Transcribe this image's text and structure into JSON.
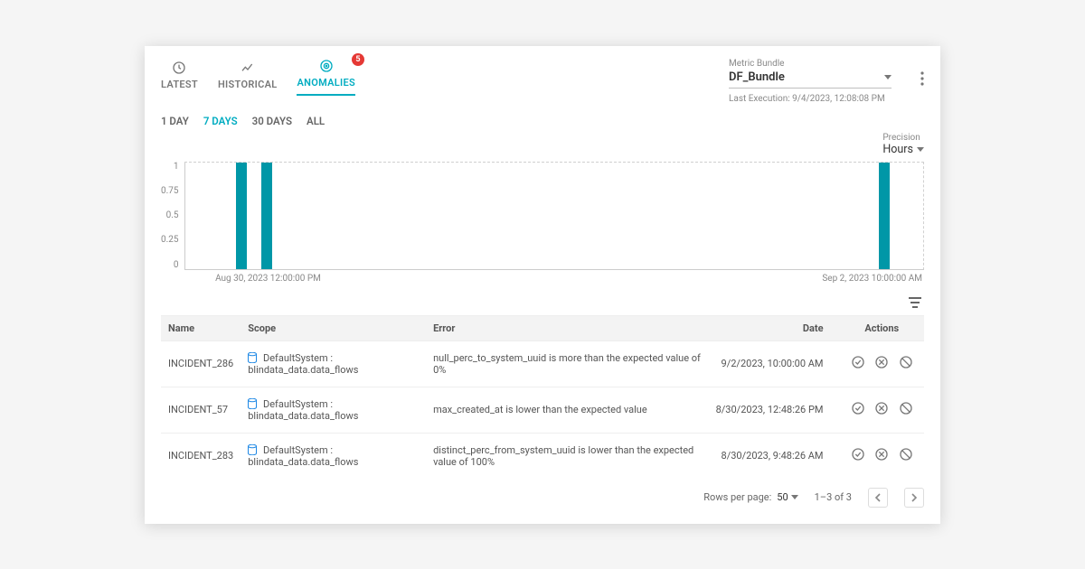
{
  "tabs": {
    "latest": "LATEST",
    "historical": "HISTORICAL",
    "anomalies": "ANOMALIES",
    "anomaly_badge": "5"
  },
  "bundle": {
    "label": "Metric Bundle",
    "value": "DF_Bundle",
    "last_exec_label": "Last Execution:",
    "last_exec_value": "9/4/2023, 12:08:08 PM"
  },
  "range": {
    "d1": "1 DAY",
    "d7": "7 DAYS",
    "d30": "30 DAYS",
    "all": "ALL"
  },
  "precision": {
    "label": "Precision",
    "value": "Hours"
  },
  "chart_data": {
    "type": "bar",
    "title": "",
    "xlabel": "",
    "ylabel": "",
    "ylim": [
      0,
      1
    ],
    "y_ticks": [
      "1",
      "0.75",
      "0.5",
      "0.25",
      "0"
    ],
    "x_ticks": {
      "start": "Aug 30, 2023 12:00:00 PM",
      "end": "Sep 2, 2023 10:00:00 AM"
    },
    "series": [
      {
        "name": "anomalies",
        "values": [
          {
            "x": "Aug 30, 2023 ~12:00 PM",
            "y": 1
          },
          {
            "x": "Aug 30, 2023 ~14:00 PM",
            "y": 1
          },
          {
            "x": "Sep 2, 2023 ~10:00 AM",
            "y": 1
          }
        ]
      }
    ]
  },
  "table": {
    "headers": {
      "name": "Name",
      "scope": "Scope",
      "error": "Error",
      "date": "Date",
      "actions": "Actions"
    },
    "rows": [
      {
        "name": "INCIDENT_286",
        "scope": "DefaultSystem : blindata_data.data_flows",
        "error": "null_perc_to_system_uuid is more than the expected value of 0%",
        "date": "9/2/2023, 10:00:00 AM"
      },
      {
        "name": "INCIDENT_57",
        "scope": "DefaultSystem : blindata_data.data_flows",
        "error": "max_created_at is lower than the expected value",
        "date": "8/30/2023, 12:48:26 PM"
      },
      {
        "name": "INCIDENT_283",
        "scope": "DefaultSystem : blindata_data.data_flows",
        "error": "distinct_perc_from_system_uuid is lower than the expected value of 100%",
        "date": "8/30/2023, 9:48:26 AM"
      }
    ]
  },
  "pager": {
    "rpp_label": "Rows per page:",
    "rpp_value": "50",
    "range_text": "1–3 of 3"
  }
}
